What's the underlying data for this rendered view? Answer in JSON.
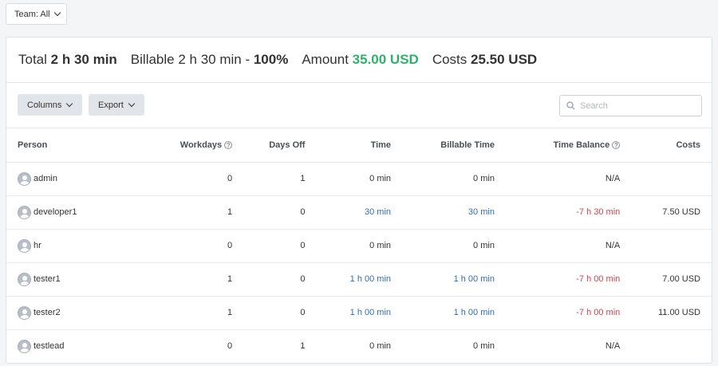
{
  "filter": {
    "team_label": "Team: All"
  },
  "summary": {
    "total_label": "Total",
    "total_value": "2 h 30 min",
    "billable_label": "Billable",
    "billable_value": "2 h 30 min - ",
    "billable_percent": "100%",
    "amount_label": "Amount",
    "amount_value": "35.00 USD",
    "costs_label": "Costs",
    "costs_value": "25.50 USD"
  },
  "toolbar": {
    "columns_label": "Columns",
    "export_label": "Export",
    "search_placeholder": "Search"
  },
  "table": {
    "headers": {
      "person": "Person",
      "workdays": "Workdays",
      "days_off": "Days Off",
      "time": "Time",
      "billable_time": "Billable Time",
      "time_balance": "Time Balance",
      "costs": "Costs"
    },
    "rows": [
      {
        "person": "admin",
        "workdays": "0",
        "days_off": "1",
        "time": "0 min",
        "billable_time": "0 min",
        "time_balance": "N/A",
        "costs": ""
      },
      {
        "person": "developer1",
        "workdays": "1",
        "days_off": "0",
        "time": "30 min",
        "billable_time": "30 min",
        "time_balance": "-7 h 30 min",
        "costs": "7.50 USD"
      },
      {
        "person": "hr",
        "workdays": "0",
        "days_off": "0",
        "time": "0 min",
        "billable_time": "0 min",
        "time_balance": "N/A",
        "costs": ""
      },
      {
        "person": "tester1",
        "workdays": "1",
        "days_off": "0",
        "time": "1 h 00 min",
        "billable_time": "1 h 00 min",
        "time_balance": "-7 h 00 min",
        "costs": "7.00 USD"
      },
      {
        "person": "tester2",
        "workdays": "1",
        "days_off": "0",
        "time": "1 h 00 min",
        "billable_time": "1 h 00 min",
        "time_balance": "-7 h 00 min",
        "costs": "11.00 USD"
      },
      {
        "person": "testlead",
        "workdays": "0",
        "days_off": "1",
        "time": "0 min",
        "billable_time": "0 min",
        "time_balance": "N/A",
        "costs": ""
      }
    ]
  },
  "colors": {
    "amount_green": "#2db26b",
    "link_blue": "#2f6db5",
    "negative_red": "#e03c4a"
  }
}
